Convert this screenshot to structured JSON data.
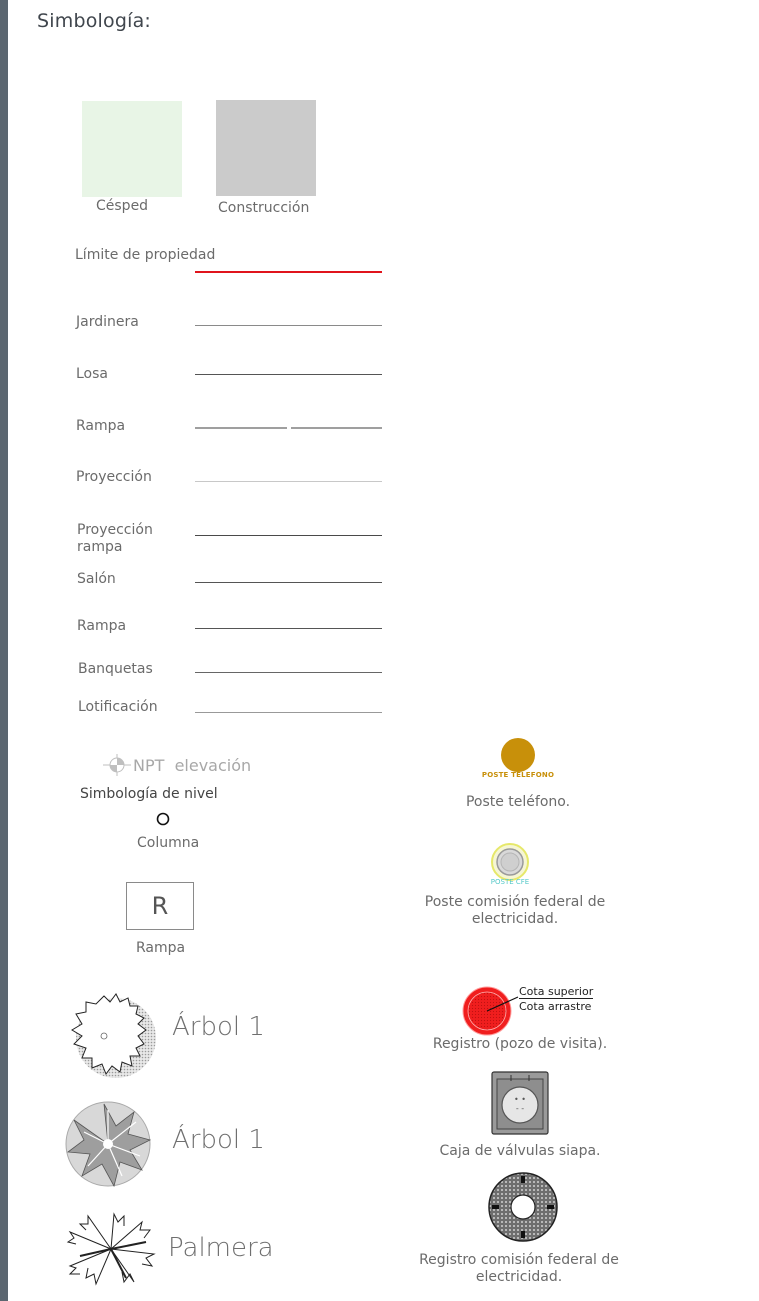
{
  "title": "Simbología:",
  "swatches": [
    {
      "label": "Césped",
      "color": "#e8f5e6"
    },
    {
      "label": "Construcción",
      "color": "#cbcbcb"
    }
  ],
  "line_legend": [
    {
      "label": "Límite de propiedad",
      "color": "#e0141c",
      "style": "solid"
    },
    {
      "label": "Jardinera",
      "color": "#8a8a8a",
      "style": "solid"
    },
    {
      "label": "Losa",
      "color": "#555555",
      "style": "solid"
    },
    {
      "label": "Rampa",
      "color": "#666666",
      "style": "dash-gap"
    },
    {
      "label": "Proyección",
      "color": "#bdbdbd",
      "style": "solid-thin"
    },
    {
      "label": "Proyección rampa",
      "color": "#4a4a4a",
      "style": "solid"
    },
    {
      "label": "Salón",
      "color": "#555555",
      "style": "solid"
    },
    {
      "label": "Rampa",
      "color": "#555555",
      "style": "solid"
    },
    {
      "label": "Banquetas",
      "color": "#666666",
      "style": "solid"
    },
    {
      "label": "Lotificación",
      "color": "#999999",
      "style": "solid"
    }
  ],
  "symbols": {
    "nivel_text": "NPT  elevación",
    "nivel_label": "Simbología de nivel",
    "columna_label": "Columna",
    "rampa_letter": "R",
    "rampa_label": "Rampa",
    "arbol1_label": "Árbol 1",
    "arbol2_label": "Árbol 1",
    "palmera_label": "Palmera",
    "poste_tel_tag": "POSTE TELEFONO",
    "poste_tel_label": "Poste teléfono.",
    "poste_cfe_tag": "POSTE CFE",
    "poste_cfe_label": "Poste comisión federal de electricidad.",
    "registro_top": "Cota superior",
    "registro_bottom": "Cota arrastre",
    "registro_label": "Registro (pozo de visita).",
    "caja_label": "Caja de válvulas siapa.",
    "registro_cfe_label": "Registro comisión federal de electricidad."
  },
  "colors": {
    "accent_bar": "#5b6670",
    "limite": "#e0141c",
    "poste_tel": "#c8900a",
    "registro": "#f01e1e",
    "cfe_ring": "#eef07a"
  }
}
